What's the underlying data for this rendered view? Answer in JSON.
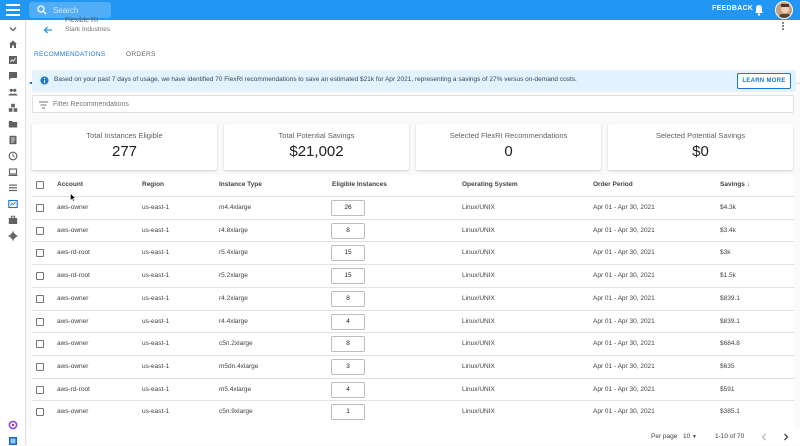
{
  "topbar": {
    "search_placeholder": "Search",
    "feedback_label": "FEEDBACK",
    "accent_color": "#2196f3"
  },
  "header": {
    "title": "Flexible RI",
    "subtitle": "Stark Industries"
  },
  "tabs": [
    {
      "label": "RECOMMENDATIONS",
      "active": true
    },
    {
      "label": "ORDERS",
      "active": false
    }
  ],
  "banner": {
    "text": "Based on your past 7 days of usage, we have identified 70 FlexRI recommendations to save an estimated $21k for Apr 2021, representing a savings of 27% versus on-demand costs.",
    "button_label": "LEARN MORE"
  },
  "filter": {
    "placeholder": "Filter Recommendations"
  },
  "cards": [
    {
      "label": "Total Instances Eligible",
      "value": "277"
    },
    {
      "label": "Total Potential Savings",
      "value": "$21,002"
    },
    {
      "label": "Selected FlexRI Recommendations",
      "value": "0"
    },
    {
      "label": "Selected Potential Savings",
      "value": "$0"
    }
  ],
  "table": {
    "headers": {
      "account": "Account",
      "region": "Region",
      "instance_type": "Instance Type",
      "eligible": "Eligible Instances",
      "os": "Operating System",
      "period": "Order Period",
      "savings": "Savings"
    },
    "sort_indicator": "↓",
    "rows": [
      {
        "account": "aws-owner",
        "region": "us-east-1",
        "instance_type": "m4.4xlarge",
        "eligible": "26",
        "os": "Linux/UNIX",
        "period": "Apr 01 - Apr 30, 2021",
        "savings": "$4.3k"
      },
      {
        "account": "aws-owner",
        "region": "us-east-1",
        "instance_type": "r4.8xlarge",
        "eligible": "8",
        "os": "Linux/UNIX",
        "period": "Apr 01 - Apr 30, 2021",
        "savings": "$3.4k"
      },
      {
        "account": "aws-rd-root",
        "region": "us-east-1",
        "instance_type": "r5.4xlarge",
        "eligible": "15",
        "os": "Linux/UNIX",
        "period": "Apr 01 - Apr 30, 2021",
        "savings": "$3k"
      },
      {
        "account": "aws-rd-root",
        "region": "us-east-1",
        "instance_type": "r5.2xlarge",
        "eligible": "15",
        "os": "Linux/UNIX",
        "period": "Apr 01 - Apr 30, 2021",
        "savings": "$1.5k"
      },
      {
        "account": "aws-owner",
        "region": "us-east-1",
        "instance_type": "r4.2xlarge",
        "eligible": "8",
        "os": "Linux/UNIX",
        "period": "Apr 01 - Apr 30, 2021",
        "savings": "$839.1"
      },
      {
        "account": "aws-owner",
        "region": "us-east-1",
        "instance_type": "r4.4xlarge",
        "eligible": "4",
        "os": "Linux/UNIX",
        "period": "Apr 01 - Apr 30, 2021",
        "savings": "$839.1"
      },
      {
        "account": "aws-owner",
        "region": "us-east-1",
        "instance_type": "c5n.2xlarge",
        "eligible": "8",
        "os": "Linux/UNIX",
        "period": "Apr 01 - Apr 30, 2021",
        "savings": "$684.8"
      },
      {
        "account": "aws-owner",
        "region": "us-east-1",
        "instance_type": "m5dn.4xlarge",
        "eligible": "3",
        "os": "Linux/UNIX",
        "period": "Apr 01 - Apr 30, 2021",
        "savings": "$635"
      },
      {
        "account": "aws-rd-root",
        "region": "us-east-1",
        "instance_type": "m5.4xlarge",
        "eligible": "4",
        "os": "Linux/UNIX",
        "period": "Apr 01 - Apr 30, 2021",
        "savings": "$591"
      },
      {
        "account": "aws-owner",
        "region": "us-east-1",
        "instance_type": "c5n.9xlarge",
        "eligible": "1",
        "os": "Linux/UNIX",
        "period": "Apr 01 - Apr 30, 2021",
        "savings": "$385.1"
      }
    ]
  },
  "footer": {
    "per_page_label": "Per page",
    "per_page_value": "10",
    "range_text": "1-10 of 70"
  },
  "sidebar_icons": [
    "chevron-down-icon",
    "home-icon",
    "reports-icon",
    "comment-icon",
    "people-icon",
    "cubes-icon",
    "folder-icon",
    "document-icon",
    "history-icon",
    "laptop-icon",
    "list-icon",
    "savings-icon",
    "briefcase-icon",
    "gear-icon",
    "logo-icon",
    "apps-icon"
  ]
}
